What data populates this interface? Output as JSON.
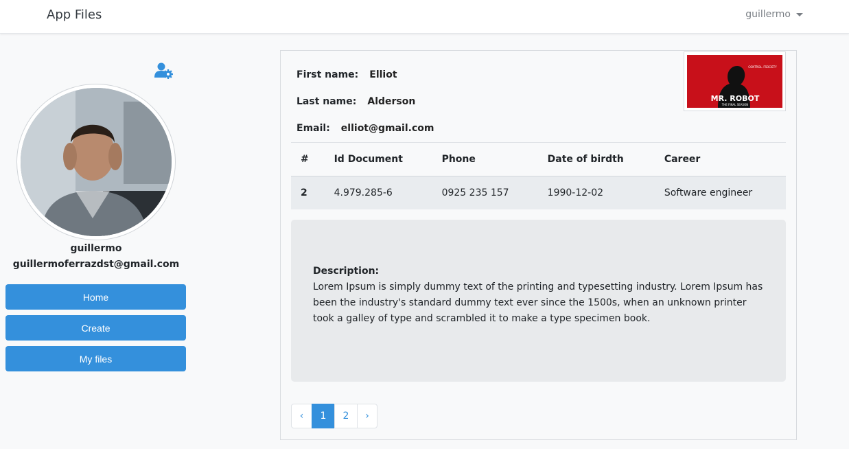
{
  "navbar": {
    "brand": "App Files",
    "user": "guillermo"
  },
  "sidebar": {
    "username": "guillermo",
    "email": "guillermoferrazdst@gmail.com",
    "buttons": [
      {
        "label": "Home"
      },
      {
        "label": "Create"
      },
      {
        "label": "My files"
      }
    ]
  },
  "profile": {
    "first_name_label": "First name:",
    "first_name": "Elliot",
    "last_name_label": "Last name:",
    "last_name": "Alderson",
    "email_label": "Email:",
    "email": "elliot@gmail.com"
  },
  "thumbnail": {
    "title": "MR. ROBOT",
    "tagline": "CONTROL. FSOCIETY",
    "subtitle": "THE FINAL SEASON"
  },
  "table": {
    "headers": [
      "#",
      "Id Document",
      "Phone",
      "Date of birdth",
      "Career"
    ],
    "rows": [
      [
        "2",
        "4.979.285-6",
        "0925 235 157",
        "1990-12-02",
        "Software engineer"
      ]
    ]
  },
  "description": {
    "title": "Description:",
    "text": "Lorem Ipsum is simply dummy text of the printing and typesetting industry. Lorem Ipsum has been the industry's standard dummy text ever since the 1500s, when an unknown printer took a galley of type and scrambled it to make a type specimen book."
  },
  "pagination": {
    "prev": "‹",
    "pages": [
      "1",
      "2"
    ],
    "next": "›",
    "active_page": "1"
  },
  "colors": {
    "accent": "#3490dc",
    "background": "#f8f9fa",
    "poster_red": "#d0131d"
  }
}
